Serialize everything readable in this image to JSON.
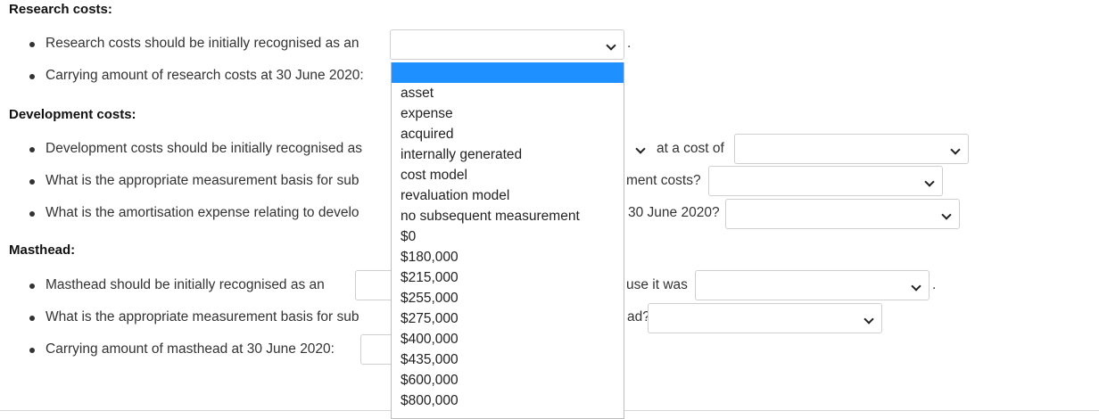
{
  "research": {
    "heading": "Research costs:",
    "q1": "Research costs should be initially recognised as an",
    "q1_after": ".",
    "q2": "Carrying amount of research costs at 30 June 2020:"
  },
  "development": {
    "heading": "Development costs:",
    "q1": "Development costs should be initially recognised as",
    "q1_mid": "at a cost of",
    "q2": "What is the appropriate measurement basis for sub",
    "q2_tail": "ment costs?",
    "q3": "What is the amortisation expense relating to develo",
    "q3_tail": "30 June 2020?"
  },
  "masthead": {
    "heading": "Masthead:",
    "q1": "Masthead should be initially recognised as an",
    "q1_mid": "use it was",
    "q1_after": ".",
    "q2": "What is the appropriate measurement basis for sub",
    "q2_tail": "ad?",
    "q3": "Carrying amount of masthead at 30 June 2020:"
  },
  "dropdown_options": [
    "asset",
    "expense",
    "acquired",
    "internally generated",
    "cost model",
    "revaluation model",
    "no subsequent measurement",
    "$0",
    "$180,000",
    "$215,000",
    "$255,000",
    "$275,000",
    "$400,000",
    "$435,000",
    "$600,000",
    "$800,000"
  ],
  "colors": {
    "highlight": "#1e90ff",
    "border": "#cfcfcf"
  }
}
